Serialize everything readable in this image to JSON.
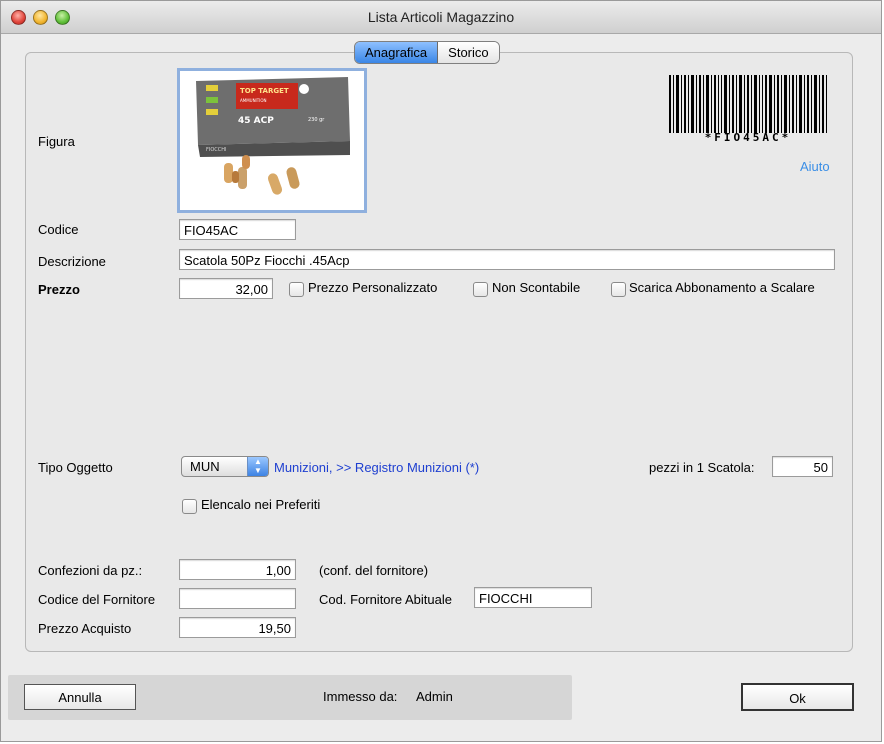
{
  "window": {
    "title": "Lista Articoli Magazzino"
  },
  "tabs": [
    {
      "label": "Anagrafica",
      "active": true
    },
    {
      "label": "Storico",
      "active": false
    }
  ],
  "figure": {
    "label": "Figura",
    "image_text": {
      "brand": "TOP TARGET",
      "subtitle": "AMMUNITION",
      "caliber": "45 ACP",
      "weight": "230 gr",
      "maker": "FIOCCHI"
    }
  },
  "barcode": {
    "text": "*FIO45AC*"
  },
  "help_link": "Aiuto",
  "fields": {
    "codice": {
      "label": "Codice",
      "value": "FIO45AC"
    },
    "descrizione": {
      "label": "Descrizione",
      "value": "Scatola 50Pz Fiocchi .45Acp"
    },
    "prezzo": {
      "label": "Prezzo",
      "value": "32,00"
    }
  },
  "checkboxes": {
    "prezzo_personalizzato": {
      "label": "Prezzo Personalizzato",
      "checked": false
    },
    "non_scontabile": {
      "label": "Non Scontabile",
      "checked": false
    },
    "scarica_abbonamento": {
      "label": "Scarica Abbonamento a Scalare",
      "checked": false
    },
    "preferiti": {
      "label": "Elencalo nei Preferiti",
      "checked": false
    }
  },
  "tipo_oggetto": {
    "label": "Tipo Oggetto",
    "selected": "MUN",
    "link": "Munizioni, >> Registro Munizioni (*)",
    "pezzi_label": "pezzi in 1 Scatola:",
    "pezzi_value": "50"
  },
  "fornitore": {
    "confezioni_label": "Confezioni da pz.:",
    "confezioni_value": "1,00",
    "confezioni_note": "(conf. del fornitore)",
    "codice_fornitore_label": "Codice del Fornitore",
    "codice_fornitore_value": "",
    "cod_abituale_label": "Cod. Fornitore Abituale",
    "cod_abituale_value": "FIOCCHI",
    "prezzo_acquisto_label": "Prezzo Acquisto",
    "prezzo_acquisto_value": "19,50"
  },
  "footer": {
    "cancel_label": "Annulla",
    "immesso_label": "Immesso da:",
    "immesso_value": "Admin",
    "ok_label": "Ok"
  }
}
